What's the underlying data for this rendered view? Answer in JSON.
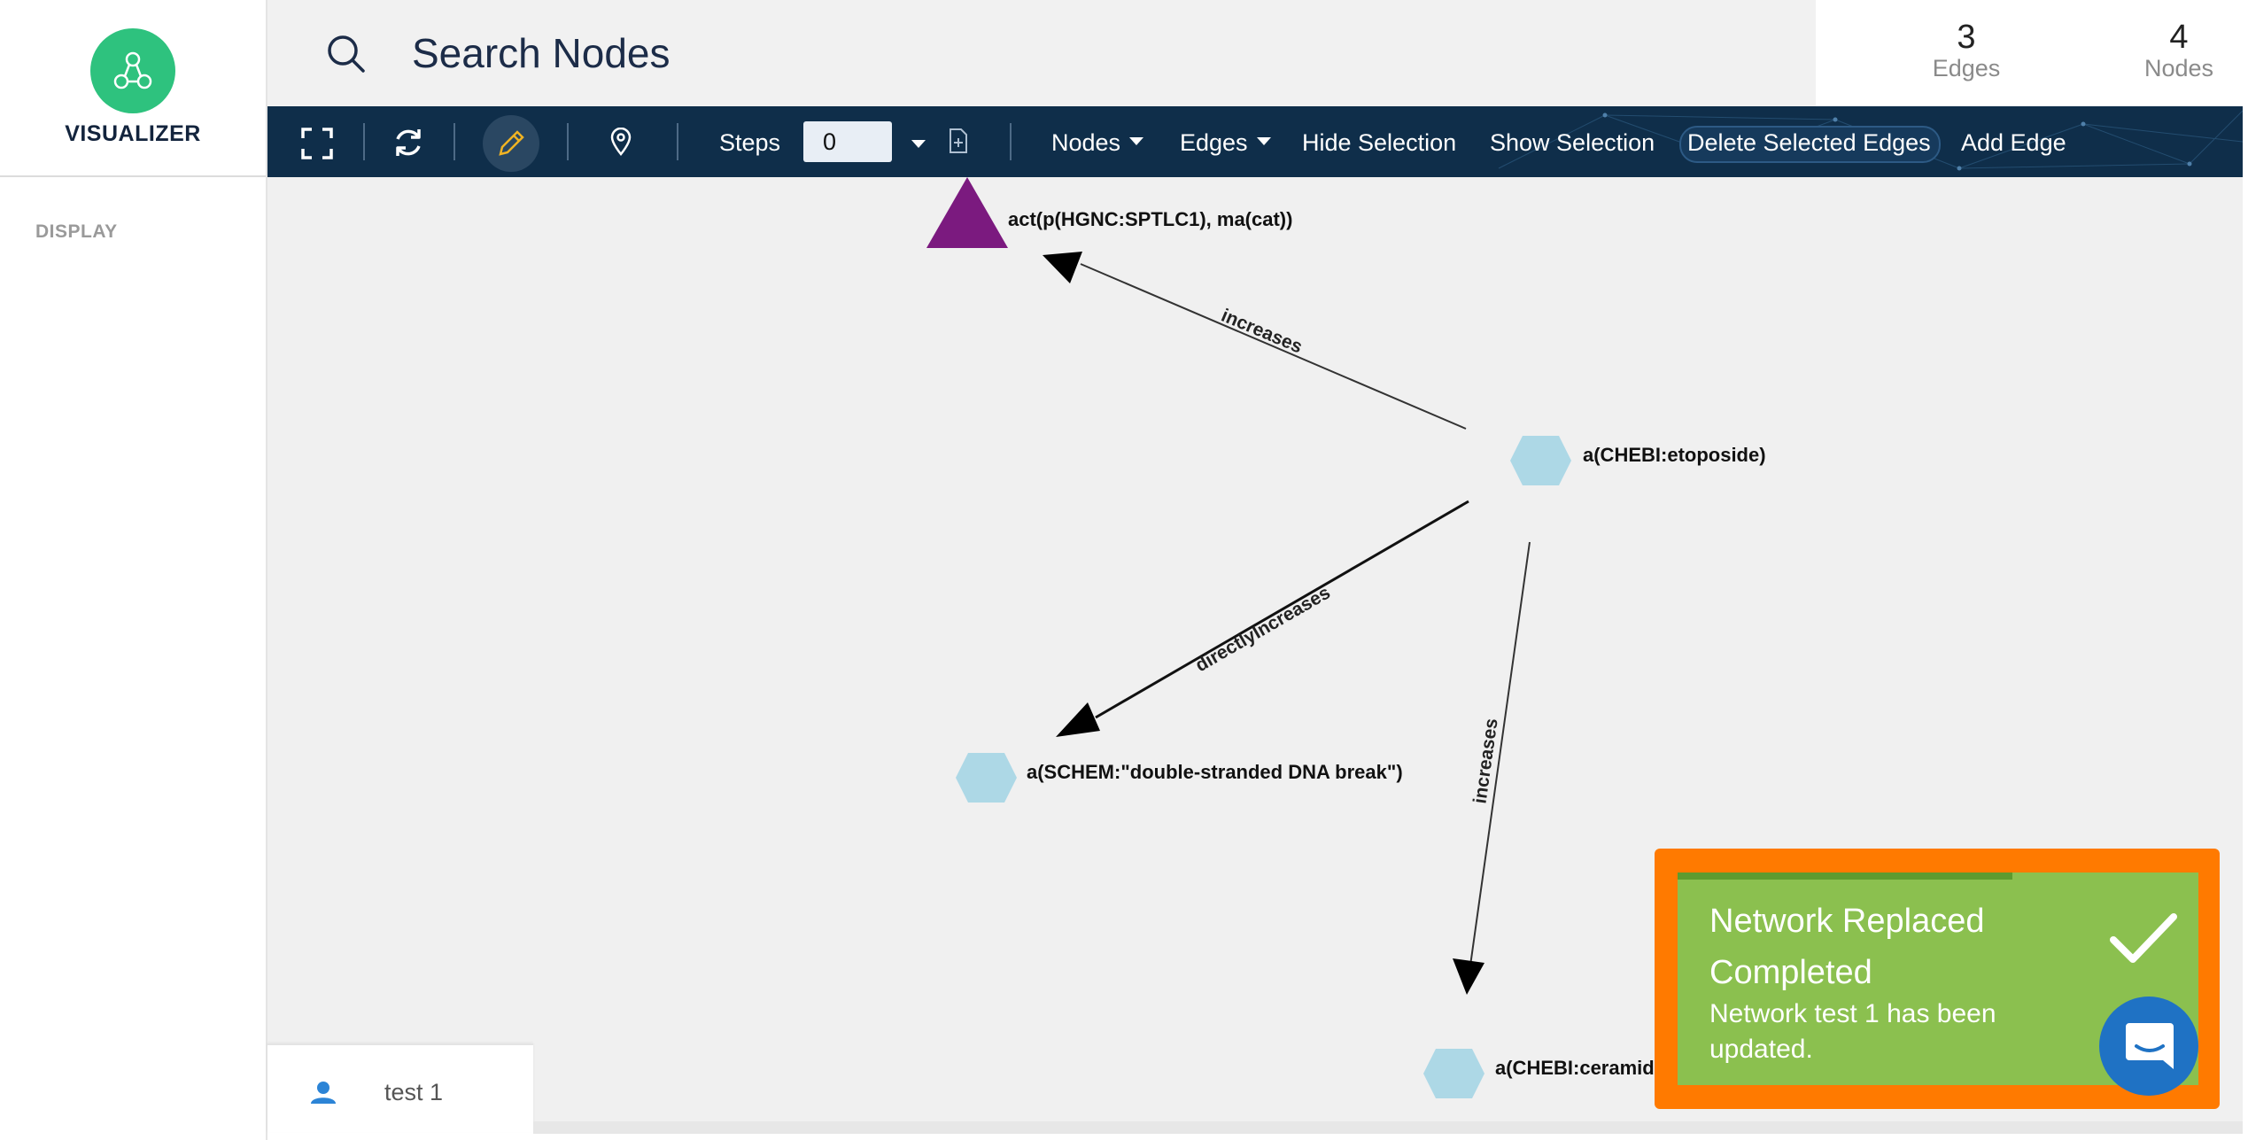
{
  "sidebar": {
    "app_name": "VISUALIZER",
    "section_label": "DISPLAY",
    "logo_icon": "network-nodes-icon"
  },
  "search": {
    "placeholder": "Search Nodes",
    "icon": "search-icon"
  },
  "stats": {
    "edges_count": "3",
    "edges_label": "Edges",
    "nodes_count": "4",
    "nodes_label": "Nodes"
  },
  "toolbar": {
    "icons": [
      "fullscreen-icon",
      "refresh-icon",
      "edit-pencil-icon",
      "location-pin-icon",
      "add-file-icon"
    ],
    "steps_label": "Steps",
    "steps_value": "0",
    "nodes_menu": "Nodes",
    "edges_menu": "Edges",
    "hide_selection": "Hide Selection",
    "show_selection": "Show Selection",
    "delete_selected_edges": "Delete Selected Edges",
    "add_edge": "Add Edge"
  },
  "graph": {
    "nodes": [
      {
        "id": "n1",
        "label": "act(p(HGNC:SPTLC1), ma(cat))",
        "shape": "triangle",
        "color": "#7b1a7f"
      },
      {
        "id": "n2",
        "label": "a(CHEBI:etoposide)",
        "shape": "hexagon",
        "color": "#add8e6"
      },
      {
        "id": "n3",
        "label": "a(SCHEM:\"double-stranded DNA break\")",
        "shape": "hexagon",
        "color": "#add8e6"
      },
      {
        "id": "n4",
        "label": "a(CHEBI:ceramid",
        "shape": "hexagon",
        "color": "#add8e6"
      }
    ],
    "edges": [
      {
        "source": "n2",
        "target": "n1",
        "label": "increases"
      },
      {
        "source": "n2",
        "target": "n3",
        "label": "directlyIncreases"
      },
      {
        "source": "n2",
        "target": "n4",
        "label": "increases"
      }
    ]
  },
  "network_tab": {
    "label": "test 1",
    "icon": "user-icon"
  },
  "toast": {
    "title": "Network Replaced Completed",
    "message": "Network test 1 has been updated.",
    "icon": "checkmark-icon",
    "color": "#8bc04f",
    "highlight_color": "#ff7a00"
  },
  "chat": {
    "icon": "chat-bubble-icon",
    "color": "#1f72c4"
  }
}
